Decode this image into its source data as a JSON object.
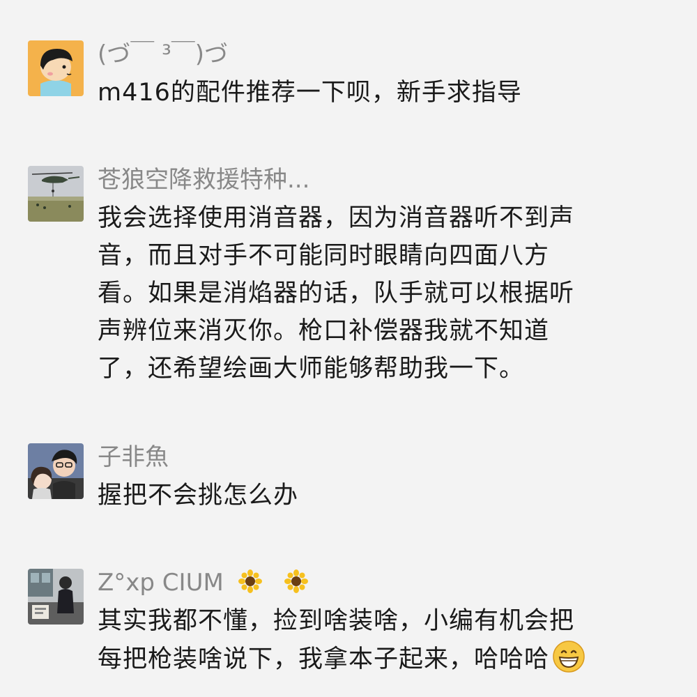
{
  "comments": [
    {
      "username": "(づ￣ ³￣)づ",
      "avatar_icon": "cartoon-boy-avatar",
      "lines": [
        "m416的配件推荐一下呗，新手求指导"
      ]
    },
    {
      "username": "苍狼空降救援特种...",
      "avatar_icon": "helicopter-photo-avatar",
      "lines": [
        "我会选择使用消音器，因为消音器听不到声",
        "音，而且对手不可能同时眼睛向四面八方",
        "看。如果是消焰器的话，队手就可以根据听",
        "声辨位来消灭你。枪口补偿器我就不知道",
        "了，还希望绘画大师能够帮助我一下。"
      ]
    },
    {
      "username": "子非魚",
      "avatar_icon": "couple-photo-avatar",
      "lines": [
        "握把不会挑怎么办"
      ]
    },
    {
      "username": "Z°xp CIUM",
      "username_emoji": "sunflower-icon",
      "avatar_icon": "street-photo-avatar",
      "lines": [
        "其实我都不懂，捡到啥装啥，小编有机会把",
        "每把枪装啥说下，我拿本子起来，哈哈哈"
      ],
      "trailing_emoji": "grinning-face-icon"
    }
  ],
  "colors": {
    "background": "#f3f3f3",
    "username": "#888888",
    "text": "#1a1a1a"
  }
}
